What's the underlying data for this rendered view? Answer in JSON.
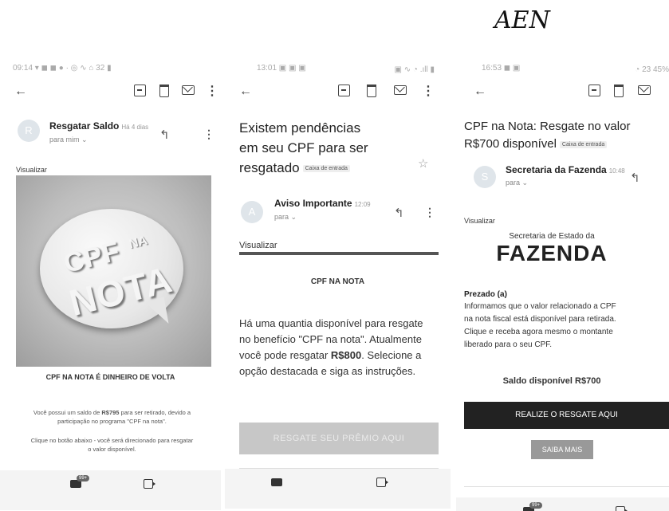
{
  "figure_label": "AEN",
  "panel1": {
    "status_bar": "09:14 ▾ ◼ ◼ ● ·      ◎ ∿  ⌂ 32 ▮",
    "sender": "Resgatar Saldo",
    "time": "Há 4 dias",
    "to": "para mim ⌄",
    "avatar": "R",
    "visualize": "Visualizar",
    "logo_cpf": "CPF",
    "logo_na": "NA",
    "logo_nota": "NOTA",
    "heading": "CPF NA NOTA É DINHEIRO DE VOLTA",
    "body1_pre": "Você possui um saldo de ",
    "body1_amount": "R$795",
    "body1_post": " para ser retirado, devido a",
    "body1_line2": "participação no programa \"CPF na nota\".",
    "body2_line1": "Clique no botão abaixo - você será direcionado para resgatar",
    "body2_line2": "o valor disponível.",
    "nav_count": "99+"
  },
  "panel2": {
    "status_bar": "13:01 ▣ ▣ ▣",
    "status_right": "▣ ∿ ◔ .ıll ▮",
    "subject_line1": "Existem pendências",
    "subject_line2": "em seu CPF para ser",
    "subject_line3": "resgatado",
    "inbox_badge": "Caixa de entrada",
    "sender": "Aviso Importante",
    "time": "12:09",
    "to": "para ⌄",
    "avatar": "A",
    "visualize": "Visualizar",
    "heading": "CPF NA NOTA",
    "line1": "Há uma quantia disponível para resgate",
    "line2": "no benefício \"CPF na nota\". Atualmente",
    "line3_pre": "você pode resgatar ",
    "line3_amount": "R$800",
    "line3_post": ". Selecione a",
    "line4": "opção destacada e siga as instruções.",
    "button": "RESGATE SEU PRÊMIO AQUI"
  },
  "panel3": {
    "status_bar": "16:53 ◼ ▣",
    "status_right": "◔ 23 45%",
    "subject_line1": "CPF na Nota: Resgate no valor",
    "subject_line2": "R$700 disponível",
    "inbox_badge": "Caixa de entrada",
    "sender": "Secretaria da Fazenda",
    "time": "10:48",
    "to": "para ⌄",
    "avatar": "S",
    "visualize": "Visualizar",
    "org_small": "Secretaria de Estado da",
    "org_big": "FAZENDA",
    "greeting": "Prezado (a)",
    "line1": "Informamos que o valor relacionado a CPF",
    "line2": "na nota fiscal está disponível para retirada.",
    "line3": "Clique e receba agora mesmo o montante",
    "line4": "liberado para o seu CPF.",
    "balance": "Saldo disponível R$700",
    "primary_button": "REALIZE O RESGATE AQUI",
    "secondary_button": "SAIBA MAIS",
    "nav_count": "99+"
  }
}
